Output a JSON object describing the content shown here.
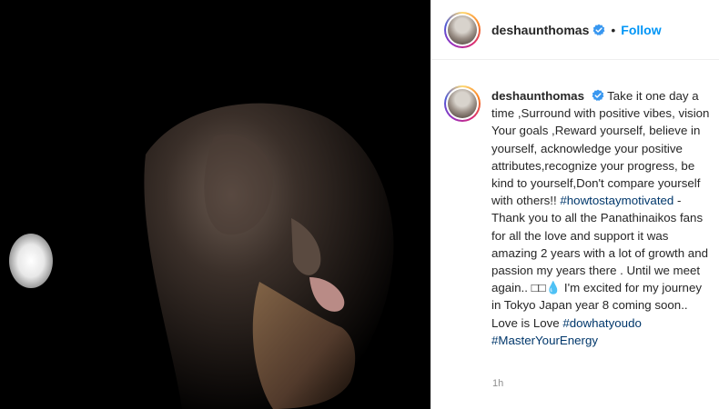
{
  "header": {
    "username": "deshaunthomas",
    "separator": "•",
    "follow_label": "Follow"
  },
  "caption": {
    "username": "deshaunthomas",
    "text_1": "Take it one day a time ,Surround with positive vibes, vision Your goals ,Reward yourself, believe in yourself, acknowledge your positive attributes,recognize your progress, be kind to yourself,Don't compare yourself with others!!",
    "hashtag_1": "#howtostaymotivated",
    "text_2": " - Thank you to all the Panathinaikos fans for all the love and support it was amazing 2 years with a lot of growth and passion my years there . Until we meet again.. □□💧 I'm excited for my journey in Tokyo Japan year 8 coming soon.. Love is Love ",
    "hashtag_2": "#dowhatyoudo",
    "hashtag_3": "#MasterYourEnergy"
  },
  "timestamp": "1h",
  "icons": {
    "verified": "verified-badge-icon",
    "photo": "post-photo"
  },
  "colors": {
    "link": "#0095f6",
    "hashtag": "#00376b",
    "verified": "#3897f0"
  }
}
